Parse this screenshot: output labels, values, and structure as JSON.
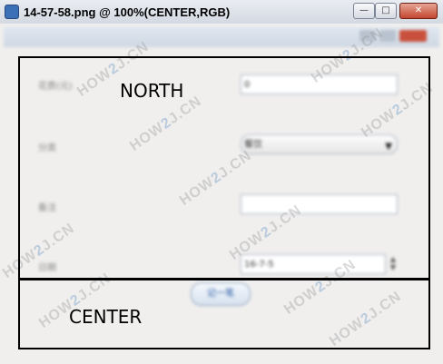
{
  "window": {
    "title": "14-57-58.png @ 100%(CENTER,RGB)",
    "buttons": {
      "minimize": "—",
      "maximize": "□",
      "close": "✕"
    }
  },
  "form": {
    "fields": [
      {
        "label": "花费(元)",
        "value": "0"
      },
      {
        "label": "分类",
        "value": "餐饮"
      },
      {
        "label": "备注",
        "value": ""
      },
      {
        "label": "日期",
        "value": "16-7-5"
      }
    ],
    "submit_label": "记一笔"
  },
  "regions": {
    "north": "NORTH",
    "center": "CENTER"
  },
  "watermark": {
    "prefix": "HOW",
    "two": "2",
    "suffix": "J.CN"
  },
  "icons": [
    "app-icon",
    "chevron-down-icon",
    "spinner-arrows-icon"
  ]
}
